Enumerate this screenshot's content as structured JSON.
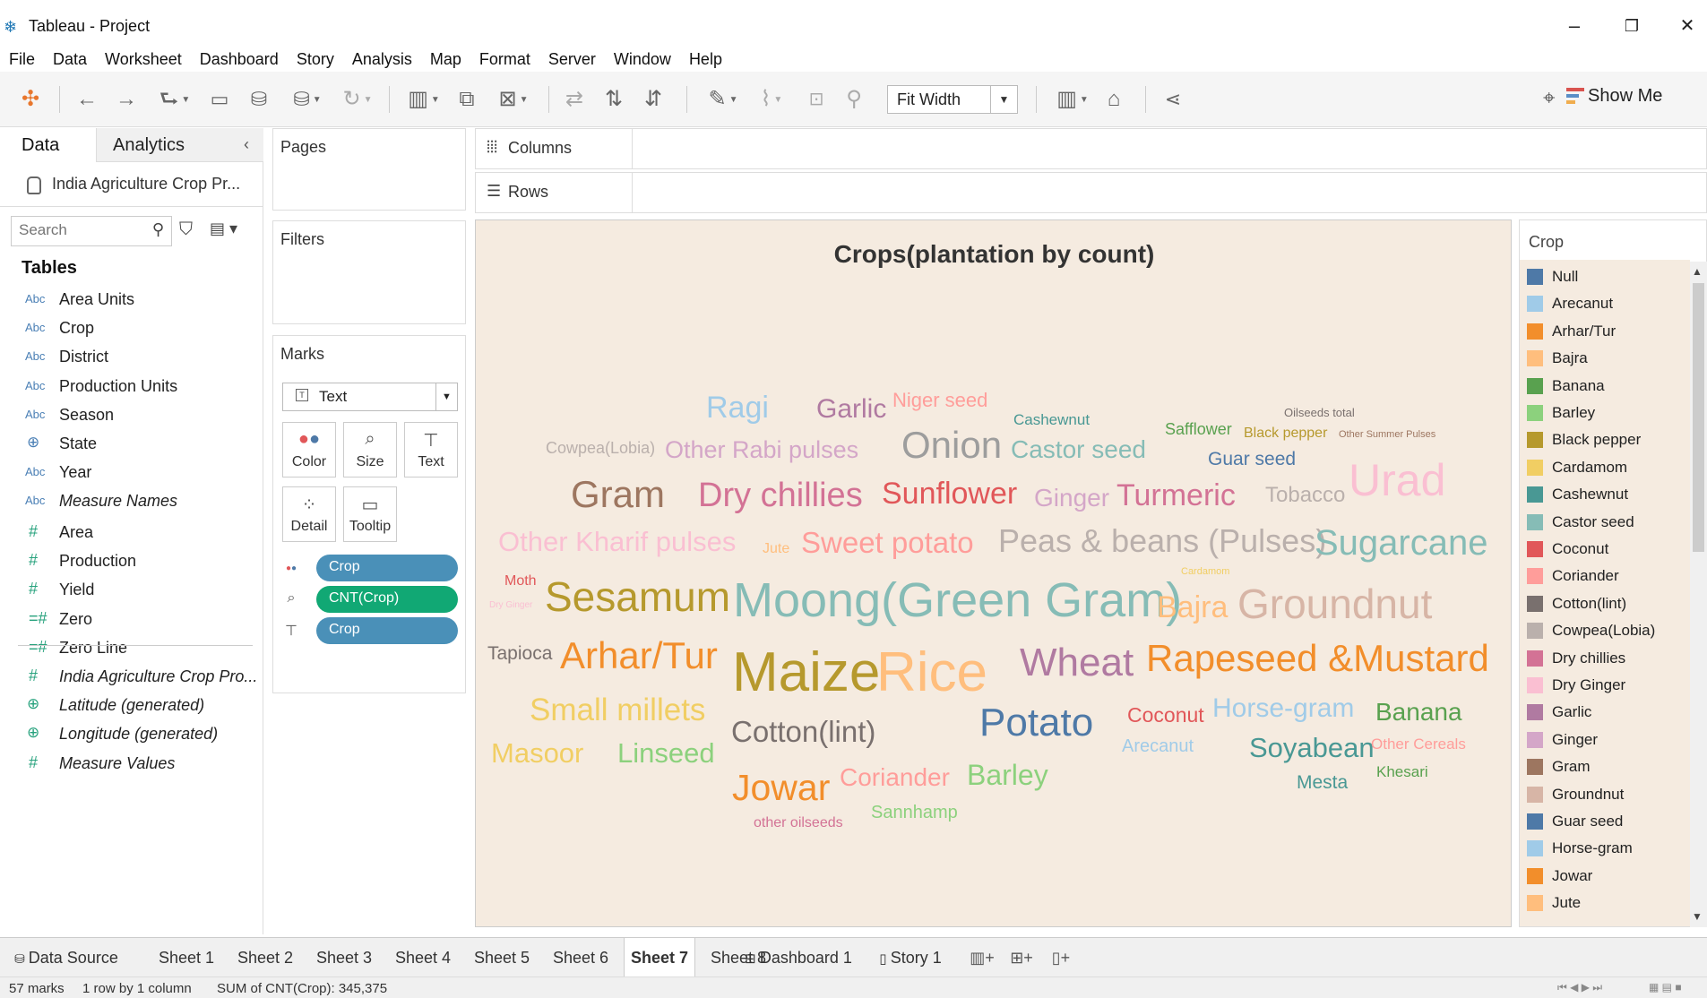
{
  "window": {
    "title": "Tableau - Project",
    "minimize": "–",
    "restore": "❐",
    "close": "✕"
  },
  "menu": [
    "File",
    "Data",
    "Worksheet",
    "Dashboard",
    "Story",
    "Analysis",
    "Map",
    "Format",
    "Server",
    "Window",
    "Help"
  ],
  "toolbar": {
    "fit": "Fit Width",
    "show_me": "Show Me"
  },
  "data_pane": {
    "tab_data": "Data",
    "tab_analytics": "Analytics",
    "datasource": "India Agriculture Crop Pr...",
    "search_placeholder": "Search",
    "tables_heading": "Tables",
    "dimensions": [
      {
        "type": "Abc",
        "name": "Area Units"
      },
      {
        "type": "Abc",
        "name": "Crop"
      },
      {
        "type": "Abc",
        "name": "District"
      },
      {
        "type": "Abc",
        "name": "Production Units"
      },
      {
        "type": "Abc",
        "name": "Season"
      },
      {
        "type": "geo",
        "name": "State"
      },
      {
        "type": "Abc",
        "name": "Year"
      },
      {
        "type": "Abc",
        "name": "Measure Names"
      }
    ],
    "measures": [
      {
        "type": "#",
        "name": "Area"
      },
      {
        "type": "#",
        "name": "Production"
      },
      {
        "type": "#",
        "name": "Yield"
      },
      {
        "type": "=#",
        "name": "Zero"
      },
      {
        "type": "=#",
        "name": "Zero Line"
      },
      {
        "type": "#",
        "name": "India Agriculture Crop Pro..."
      },
      {
        "type": "geo",
        "name": "Latitude (generated)"
      },
      {
        "type": "geo",
        "name": "Longitude (generated)"
      },
      {
        "type": "#",
        "name": "Measure Values"
      }
    ]
  },
  "cards": {
    "pages": "Pages",
    "filters": "Filters",
    "marks": "Marks",
    "mark_type": "Text",
    "buttons": [
      "Color",
      "Size",
      "Text",
      "Detail",
      "Tooltip"
    ],
    "pills": [
      {
        "icon": "color",
        "label": "Crop",
        "kind": "dim"
      },
      {
        "icon": "size",
        "label": "CNT(Crop)",
        "kind": "meas"
      },
      {
        "icon": "text",
        "label": "Crop",
        "kind": "dim"
      }
    ]
  },
  "shelves": {
    "columns": "Columns",
    "rows": "Rows"
  },
  "viz": {
    "title": "Crops(plantation by count)",
    "words": [
      {
        "t": "Ragi",
        "c": "#a0cbe8"
      },
      {
        "t": "Garlic",
        "c": "#b07aa1"
      },
      {
        "t": "Niger seed",
        "c": "#ff9d9a"
      },
      {
        "t": "Cashewnut",
        "c": "#499894"
      },
      {
        "t": "Safflower",
        "c": "#59a14f"
      },
      {
        "t": "Oilseeds total",
        "c": "#79706e"
      },
      {
        "t": "Black pepper",
        "c": "#b6992d"
      },
      {
        "t": "Other Summer Pulses",
        "c": "#9d7660"
      },
      {
        "t": "Cowpea(Lobia)",
        "c": "#bab0ac"
      },
      {
        "t": "Other Rabi pulses",
        "c": "#d4a6c8"
      },
      {
        "t": "Onion",
        "c": "#9d9d9d"
      },
      {
        "t": "Castor seed",
        "c": "#86bcb6"
      },
      {
        "t": "Guar seed",
        "c": "#4e79a7"
      },
      {
        "t": "Gram",
        "c": "#9d7660"
      },
      {
        "t": "Dry chillies",
        "c": "#d37295"
      },
      {
        "t": "Sunflower",
        "c": "#e15759"
      },
      {
        "t": "Ginger",
        "c": "#d4a6c8"
      },
      {
        "t": "Turmeric",
        "c": "#d37295"
      },
      {
        "t": "Tobacco",
        "c": "#bab0ac"
      },
      {
        "t": "Urad",
        "c": "#fabfd2"
      },
      {
        "t": "Other Kharif pulses",
        "c": "#fabfd2"
      },
      {
        "t": "Jute",
        "c": "#ffbe7d"
      },
      {
        "t": "Sweet potato",
        "c": "#ff9d9a"
      },
      {
        "t": "Peas & beans (Pulses)",
        "c": "#bab0ac"
      },
      {
        "t": "Sugarcane",
        "c": "#86bcb6"
      },
      {
        "t": "Cardamom",
        "c": "#f1ce63"
      },
      {
        "t": "Moth",
        "c": "#e15759"
      },
      {
        "t": "Dry Ginger",
        "c": "#fabfd2"
      },
      {
        "t": "Sesamum",
        "c": "#b6992d"
      },
      {
        "t": "Moong(Green Gram)",
        "c": "#86bcb6"
      },
      {
        "t": "Bajra",
        "c": "#ffbe7d"
      },
      {
        "t": "Groundnut",
        "c": "#d7b5a6"
      },
      {
        "t": "Tapioca",
        "c": "#79706e"
      },
      {
        "t": "Arhar/Tur",
        "c": "#f28e2b"
      },
      {
        "t": "Maize",
        "c": "#b6992d"
      },
      {
        "t": "Rice",
        "c": "#ffbe7d"
      },
      {
        "t": "Wheat",
        "c": "#b07aa1"
      },
      {
        "t": "Rapeseed &Mustard",
        "c": "#f28e2b"
      },
      {
        "t": "Small millets",
        "c": "#f1ce63"
      },
      {
        "t": "Cotton(lint)",
        "c": "#79706e"
      },
      {
        "t": "Potato",
        "c": "#4e79a7"
      },
      {
        "t": "Coconut",
        "c": "#e15759"
      },
      {
        "t": "Horse-gram",
        "c": "#a0cbe8"
      },
      {
        "t": "Banana",
        "c": "#59a14f"
      },
      {
        "t": "Masoor",
        "c": "#f1ce63"
      },
      {
        "t": "Linseed",
        "c": "#8cd17d"
      },
      {
        "t": "Arecanut",
        "c": "#a0cbe8"
      },
      {
        "t": "Soyabean",
        "c": "#499894"
      },
      {
        "t": "Other Cereals",
        "c": "#ff9d9a"
      },
      {
        "t": "Jowar",
        "c": "#f28e2b"
      },
      {
        "t": "Coriander",
        "c": "#ff9d9a"
      },
      {
        "t": "Barley",
        "c": "#8cd17d"
      },
      {
        "t": "Mesta",
        "c": "#499894"
      },
      {
        "t": "Khesari",
        "c": "#59a14f"
      },
      {
        "t": "Sannhamp",
        "c": "#8cd17d"
      },
      {
        "t": "other oilseeds",
        "c": "#d37295"
      }
    ]
  },
  "legend": {
    "title": "Crop",
    "items": [
      {
        "label": "Null",
        "color": "#4e79a7"
      },
      {
        "label": "Arecanut",
        "color": "#a0cbe8"
      },
      {
        "label": "Arhar/Tur",
        "color": "#f28e2b"
      },
      {
        "label": "Bajra",
        "color": "#ffbe7d"
      },
      {
        "label": "Banana",
        "color": "#59a14f"
      },
      {
        "label": "Barley",
        "color": "#8cd17d"
      },
      {
        "label": "Black pepper",
        "color": "#b6992d"
      },
      {
        "label": "Cardamom",
        "color": "#f1ce63"
      },
      {
        "label": "Cashewnut",
        "color": "#499894"
      },
      {
        "label": "Castor seed",
        "color": "#86bcb6"
      },
      {
        "label": "Coconut",
        "color": "#e15759"
      },
      {
        "label": "Coriander",
        "color": "#ff9d9a"
      },
      {
        "label": "Cotton(lint)",
        "color": "#79706e"
      },
      {
        "label": "Cowpea(Lobia)",
        "color": "#bab0ac"
      },
      {
        "label": "Dry chillies",
        "color": "#d37295"
      },
      {
        "label": "Dry Ginger",
        "color": "#fabfd2"
      },
      {
        "label": "Garlic",
        "color": "#b07aa1"
      },
      {
        "label": "Ginger",
        "color": "#d4a6c8"
      },
      {
        "label": "Gram",
        "color": "#9d7660"
      },
      {
        "label": "Groundnut",
        "color": "#d7b5a6"
      },
      {
        "label": "Guar seed",
        "color": "#4e79a7"
      },
      {
        "label": "Horse-gram",
        "color": "#a0cbe8"
      },
      {
        "label": "Jowar",
        "color": "#f28e2b"
      },
      {
        "label": "Jute",
        "color": "#ffbe7d"
      }
    ]
  },
  "sheet_tabs": {
    "data_source": "Data Source",
    "sheets": [
      "Sheet 1",
      "Sheet 2",
      "Sheet 3",
      "Sheet 4",
      "Sheet 5",
      "Sheet 6",
      "Sheet 7",
      "Sheet 8"
    ],
    "active": "Sheet 7",
    "dashboard": "Dashboard 1",
    "story": "Story 1"
  },
  "status": {
    "marks": "57 marks",
    "dims": "1 row by 1 column",
    "sum": "SUM of CNT(Crop): 345,375"
  }
}
